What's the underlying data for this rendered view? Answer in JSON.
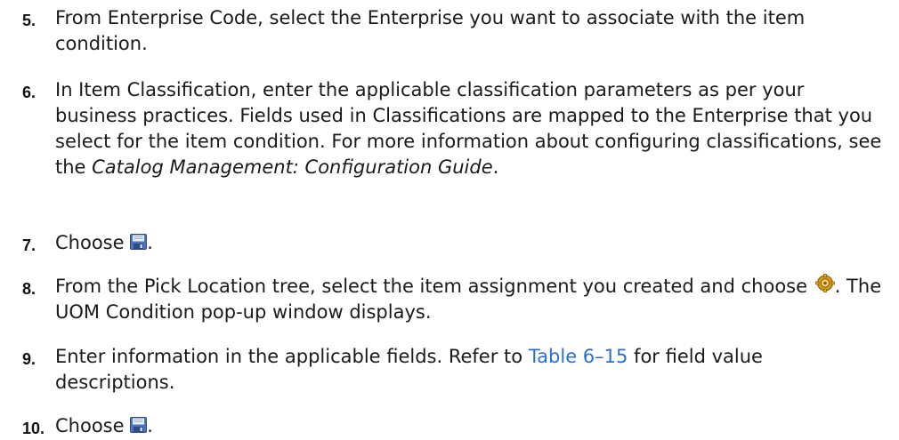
{
  "steps": [
    {
      "num": "5.",
      "text": "From Enterprise Code, select the Enterprise you want to associate with the item condition."
    },
    {
      "num": "6.",
      "text_a": "In Item Classification, enter the applicable classification parameters as per your business practices. Fields used in Classifications are mapped to the Enterprise that you select for the item condition. For more information about configuring classifications, see the ",
      "text_em": "Catalog Management: Configuration Guide",
      "text_b": "."
    },
    {
      "num": "7.",
      "text_a": "Choose ",
      "icon": "save-icon",
      "text_b": "."
    },
    {
      "num": "8.",
      "text_a": "From the Pick Location tree, select the item assignment you created and choose ",
      "icon": "gear-icon",
      "text_b": ". The UOM Condition pop-up window displays."
    },
    {
      "num": "9.",
      "text_a": "Enter information in the applicable fields. Refer to ",
      "link": "Table 6–15",
      "text_b": " for field value descriptions."
    },
    {
      "num": "10.",
      "text_a": "Choose ",
      "icon": "save-icon",
      "text_b": "."
    }
  ],
  "colors": {
    "link": "#2a6fc9",
    "text": "#1a1a1a"
  }
}
